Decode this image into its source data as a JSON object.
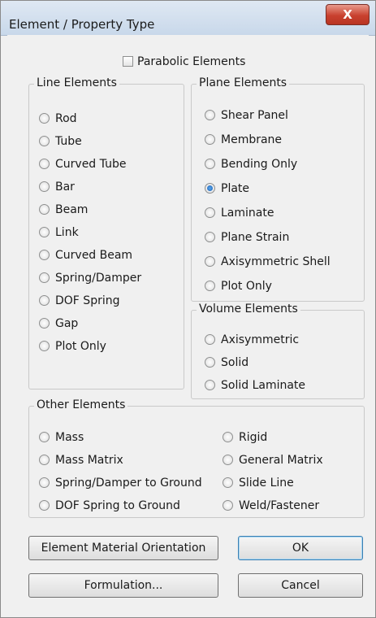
{
  "window": {
    "title": "Element / Property Type",
    "close_label": "X"
  },
  "parabolic": {
    "label": "Parabolic Elements",
    "checked": false
  },
  "line_elements": {
    "title": "Line Elements",
    "items": [
      "Rod",
      "Tube",
      "Curved Tube",
      "Bar",
      "Beam",
      "Link",
      "Curved Beam",
      "Spring/Damper",
      "DOF Spring",
      "Gap",
      "Plot Only"
    ]
  },
  "plane_elements": {
    "title": "Plane Elements",
    "items": [
      "Shear Panel",
      "Membrane",
      "Bending Only",
      "Plate",
      "Laminate",
      "Plane Strain",
      "Axisymmetric Shell",
      "Plot Only"
    ],
    "selected": "Plate"
  },
  "volume_elements": {
    "title": "Volume Elements",
    "items": [
      "Axisymmetric",
      "Solid",
      "Solid Laminate"
    ]
  },
  "other_elements": {
    "title": "Other Elements",
    "left_items": [
      "Mass",
      "Mass Matrix",
      "Spring/Damper to Ground",
      "DOF Spring to Ground"
    ],
    "right_items": [
      "Rigid",
      "General Matrix",
      "Slide Line",
      "Weld/Fastener"
    ]
  },
  "buttons": {
    "orientation": "Element Material Orientation",
    "ok": "OK",
    "formulation": "Formulation...",
    "cancel": "Cancel"
  }
}
